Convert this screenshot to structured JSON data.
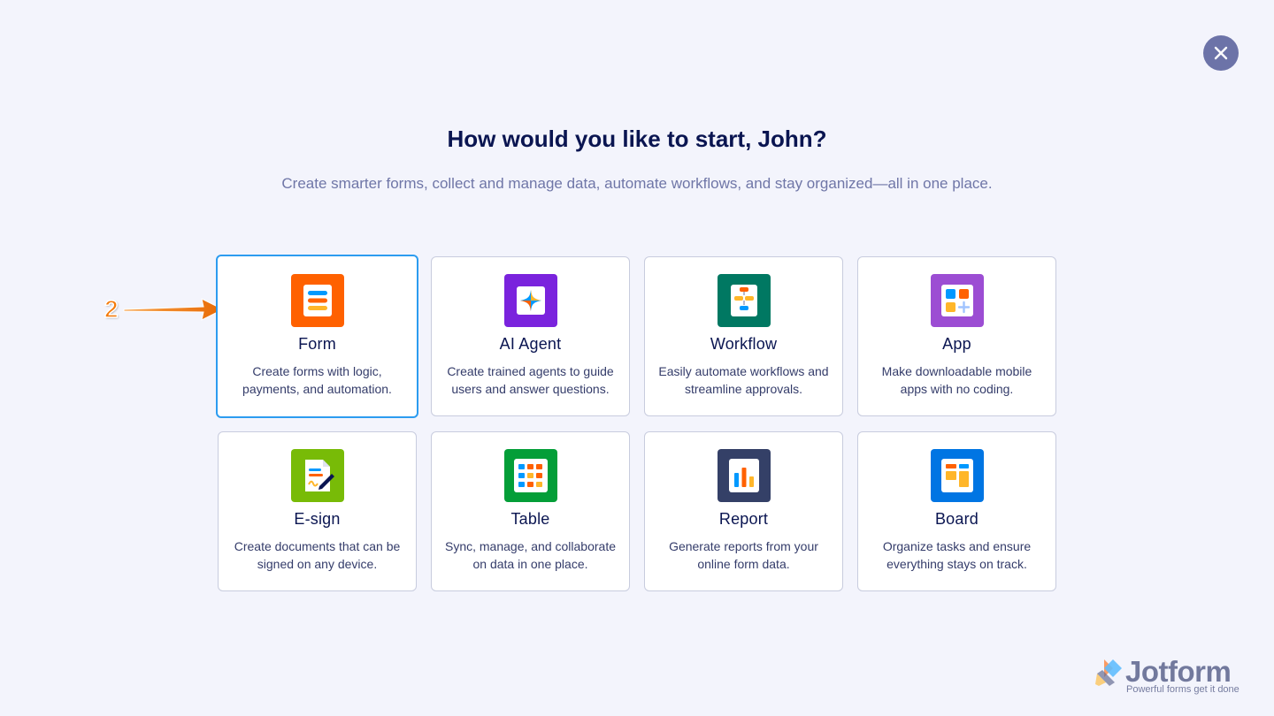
{
  "dialog": {
    "heading": "How would you like to start, John?",
    "subheading": "Create smarter forms, collect and manage data, automate workflows, and stay organized—all in one place.",
    "close_icon": "close-icon"
  },
  "annotation": {
    "number": "2"
  },
  "cards": [
    {
      "title": "Form",
      "desc": "Create forms with logic, payments, and automation.",
      "icon": "form-icon",
      "color": "#ff6100"
    },
    {
      "title": "AI Agent",
      "desc": "Create trained agents to guide users and answer questions.",
      "icon": "ai-agent-icon",
      "color": "#7a23dd"
    },
    {
      "title": "Workflow",
      "desc": "Easily automate workflows and streamline approvals.",
      "icon": "workflow-icon",
      "color": "#007862"
    },
    {
      "title": "App",
      "desc": "Make downloadable mobile apps with no coding.",
      "icon": "app-icon",
      "color": "#9c4dd3"
    },
    {
      "title": "E-sign",
      "desc": "Create documents that can be signed on any device.",
      "icon": "e-sign-icon",
      "color": "#78bb07"
    },
    {
      "title": "Table",
      "desc": "Sync, manage, and collaborate on data in one place.",
      "icon": "table-icon",
      "color": "#049e38"
    },
    {
      "title": "Report",
      "desc": "Generate reports from your online form data.",
      "icon": "report-icon",
      "color": "#344067"
    },
    {
      "title": "Board",
      "desc": "Organize tasks and ensure everything stays on track.",
      "icon": "board-icon",
      "color": "#0075e3"
    }
  ],
  "brand": {
    "name": "Jotform",
    "tagline": "Powerful forms get it done"
  }
}
